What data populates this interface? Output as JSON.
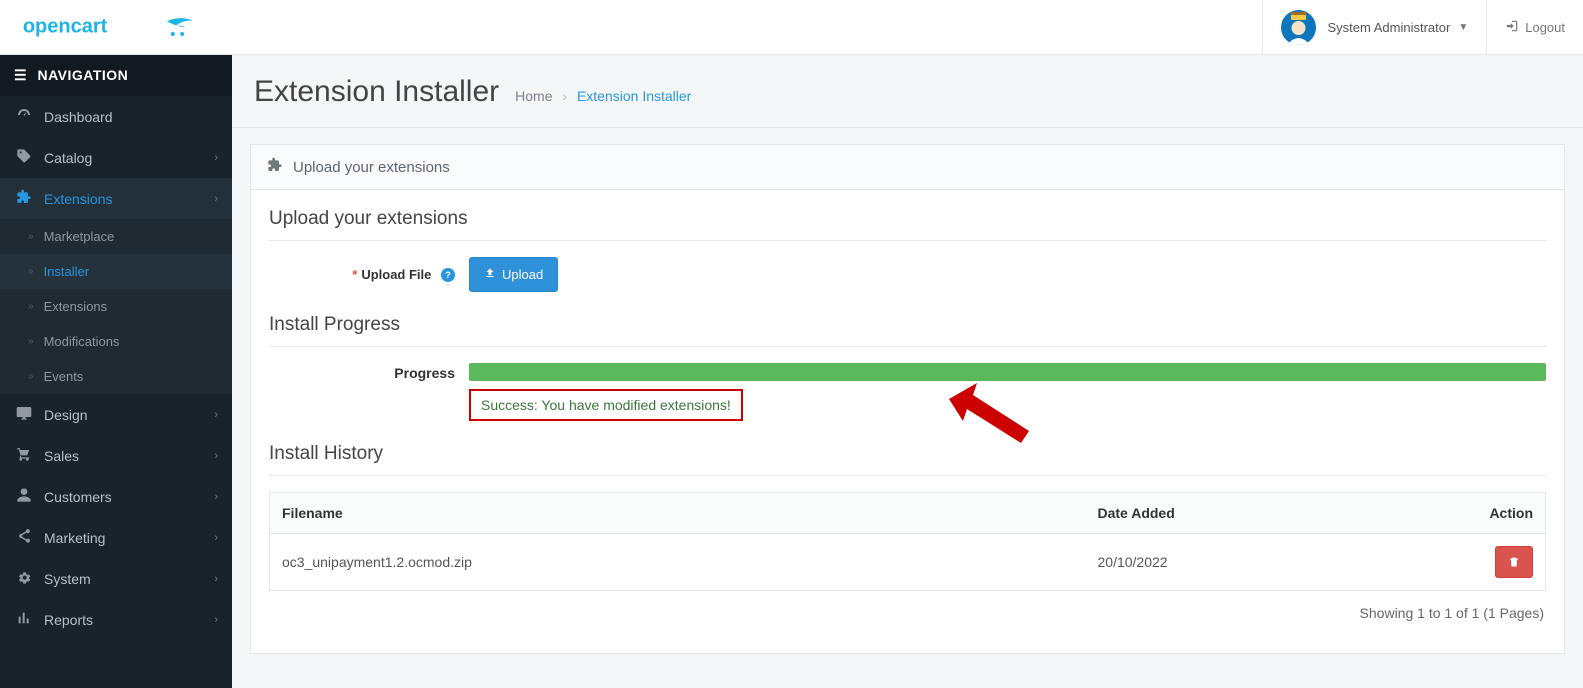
{
  "header": {
    "user_name": "System Administrator",
    "logout": "Logout"
  },
  "sidebar": {
    "title": "NAVIGATION",
    "items": {
      "dashboard": "Dashboard",
      "catalog": "Catalog",
      "extensions": "Extensions",
      "design": "Design",
      "sales": "Sales",
      "customers": "Customers",
      "marketing": "Marketing",
      "system": "System",
      "reports": "Reports"
    },
    "ext_sub": {
      "marketplace": "Marketplace",
      "installer": "Installer",
      "extensions": "Extensions",
      "modifications": "Modifications",
      "events": "Events"
    }
  },
  "page": {
    "title": "Extension Installer",
    "breadcrumb_home": "Home",
    "breadcrumb_current": "Extension Installer"
  },
  "panel": {
    "head": "Upload your extensions",
    "upload_section": "Upload your extensions",
    "upload_label": "Upload File",
    "upload_button": "Upload",
    "progress_section": "Install Progress",
    "progress_label": "Progress",
    "progress_message": "Success: You have modified extensions!",
    "history_section": "Install History",
    "table": {
      "col_filename": "Filename",
      "col_date": "Date Added",
      "col_action": "Action",
      "rows": [
        {
          "filename": "oc3_unipayment1.2.ocmod.zip",
          "date": "20/10/2022"
        }
      ]
    },
    "pager": "Showing 1 to 1 of 1 (1 Pages)"
  }
}
